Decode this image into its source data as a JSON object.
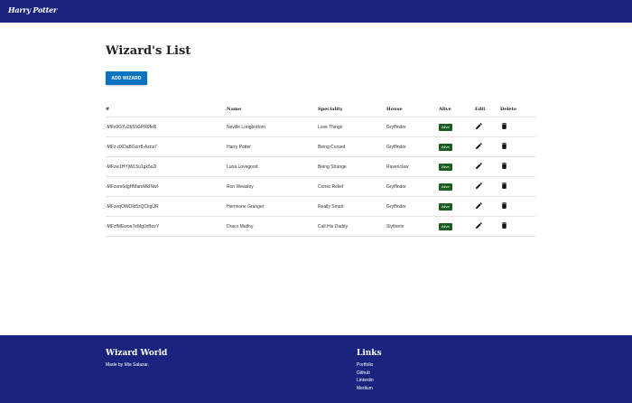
{
  "navbar": {
    "brand": "Harry Potter"
  },
  "page": {
    "title": "Wizard's List",
    "add_button": "ADD WIZARD"
  },
  "table": {
    "headers": [
      "#",
      "Name",
      "Speciality",
      "House",
      "Alive",
      "Edit",
      "Delete"
    ],
    "rows": [
      {
        "id": "-MFx9GYu2b55GPR9feR",
        "name": "Neville Longbottom",
        "speciality": "Lose Things",
        "house": "Gryffindor",
        "alive": "Alive"
      },
      {
        "id": "-MFz-dXDaBGxrr8-Azns7",
        "name": "Harry Potter",
        "speciality": "Being Cursed",
        "house": "Gryffindor",
        "alive": "Alive"
      },
      {
        "id": "-MFzw1HYjWL5u1gk5u2l",
        "name": "Luna Lovegood",
        "speciality": "Being Strange",
        "house": "Ravenclaw",
        "alive": "Alive"
      },
      {
        "id": "-MFzem6dgHMamMkINwl-",
        "name": "Ron Weasley",
        "speciality": "Comic Relief",
        "house": "Gryffindor",
        "alive": "Alive"
      },
      {
        "id": "-MFzeqOWOkt5zQCkgUR",
        "name": "Hermione Granger",
        "speciality": "Really Smart",
        "house": "Gryffindor",
        "alive": "Alive"
      },
      {
        "id": "-MFzfMEwoe7eMg0xBovY",
        "name": "Draco Malfoy",
        "speciality": "Call His Daddy",
        "house": "Slytherin",
        "alive": "Alive"
      }
    ]
  },
  "footer": {
    "title": "Wizard World",
    "credit": "Made by Mia Salazar.",
    "links_title": "Links",
    "links": [
      "Portfolio",
      "Github",
      "Linkedin",
      "Medium"
    ]
  },
  "colors": {
    "navbar": "#1a237e",
    "button": "#0b72c0",
    "alive_badge": "#1b5e20"
  },
  "icons": {
    "edit": "pencil-icon",
    "delete": "trash-icon"
  }
}
